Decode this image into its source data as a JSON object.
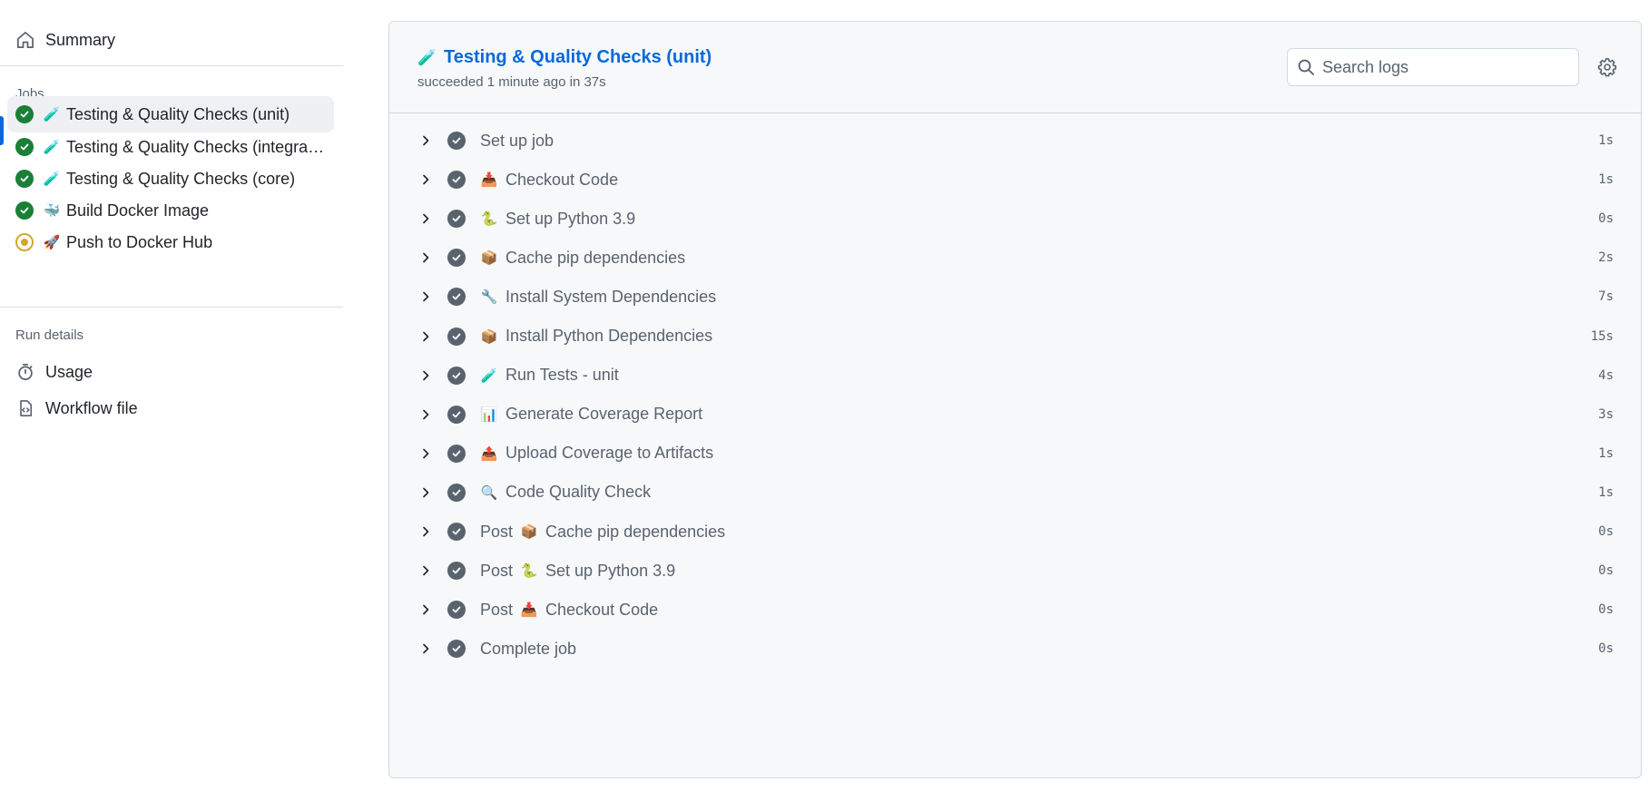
{
  "sidebar": {
    "summary_label": "Summary",
    "jobs_heading": "Jobs",
    "jobs": [
      {
        "emoji": "🧪",
        "label": "Testing & Quality Checks (unit)",
        "status": "success",
        "active": true
      },
      {
        "emoji": "🧪",
        "label": "Testing & Quality Checks (integrati...",
        "status": "success",
        "active": false
      },
      {
        "emoji": "🧪",
        "label": "Testing & Quality Checks (core)",
        "status": "success",
        "active": false
      },
      {
        "emoji": "🐳",
        "label": "Build Docker Image",
        "status": "success",
        "active": false
      },
      {
        "emoji": "🚀",
        "label": "Push to Docker Hub",
        "status": "in_progress",
        "active": false
      }
    ],
    "run_details_heading": "Run details",
    "usage_label": "Usage",
    "workflow_file_label": "Workflow file"
  },
  "job": {
    "title_emoji": "🧪",
    "title": "Testing & Quality Checks (unit)",
    "subtitle": "succeeded 1 minute ago in 37s",
    "search_placeholder": "Search logs"
  },
  "steps": [
    {
      "prefix": "",
      "emoji": "",
      "label": "Set up job",
      "duration": "1s"
    },
    {
      "prefix": "",
      "emoji": "📥",
      "label": "Checkout Code",
      "duration": "1s"
    },
    {
      "prefix": "",
      "emoji": "🐍",
      "label": "Set up Python 3.9",
      "duration": "0s"
    },
    {
      "prefix": "",
      "emoji": "📦",
      "label": "Cache pip dependencies",
      "duration": "2s"
    },
    {
      "prefix": "",
      "emoji": "🔧",
      "label": "Install System Dependencies",
      "duration": "7s"
    },
    {
      "prefix": "",
      "emoji": "📦",
      "label": "Install Python Dependencies",
      "duration": "15s"
    },
    {
      "prefix": "",
      "emoji": "🧪",
      "label": "Run Tests - unit",
      "duration": "4s"
    },
    {
      "prefix": "",
      "emoji": "📊",
      "label": "Generate Coverage Report",
      "duration": "3s"
    },
    {
      "prefix": "",
      "emoji": "📤",
      "label": "Upload Coverage to Artifacts",
      "duration": "1s"
    },
    {
      "prefix": "",
      "emoji": "🔍",
      "label": "Code Quality Check",
      "duration": "1s"
    },
    {
      "prefix": "Post",
      "emoji": "📦",
      "label": "Cache pip dependencies",
      "duration": "0s"
    },
    {
      "prefix": "Post",
      "emoji": "🐍",
      "label": "Set up Python 3.9",
      "duration": "0s"
    },
    {
      "prefix": "Post",
      "emoji": "📥",
      "label": "Checkout Code",
      "duration": "0s"
    },
    {
      "prefix": "",
      "emoji": "",
      "label": "Complete job",
      "duration": "0s"
    }
  ],
  "colors": {
    "accent": "#0969da",
    "success": "#1a7f37",
    "in_progress": "#d4a72c",
    "step_check": "#59636e"
  }
}
